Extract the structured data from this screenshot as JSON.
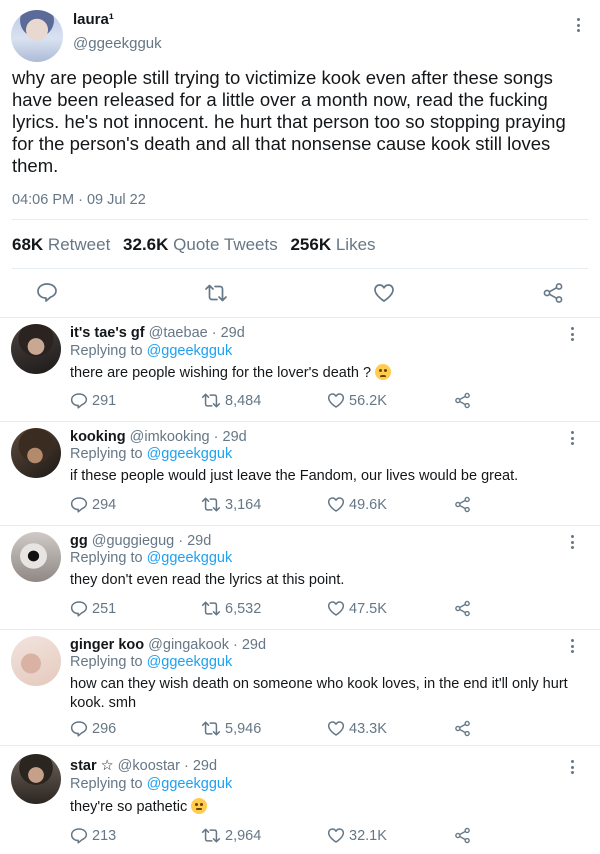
{
  "main_tweet": {
    "display_name": "laura¹",
    "handle": "@ggeekgguk",
    "text": "why are people still trying to victimize kook even after these songs have been released for a little over a month now, read the fucking lyrics. he's not innocent. he hurt that person too so stopping praying for the person's death and all that nonsense cause kook still loves them.",
    "timestamp": "04:06 PM · 09 Jul 22",
    "stats": {
      "retweets_count": "68K",
      "retweets_label": "Retweet",
      "quotes_count": "32.6K",
      "quotes_label": "Quote Tweets",
      "likes_count": "256K",
      "likes_label": "Likes"
    },
    "actions": [
      "reply-icon",
      "retweet-icon",
      "like-icon",
      "share-icon"
    ]
  },
  "replying_label": "Replying to",
  "replies": [
    {
      "name": "it's tae's gf",
      "meta": "@taebae · 29d",
      "replying_to": "@ggeekgguk",
      "text": "there are people wishing for the lover's death ?",
      "emoji": "worried-face",
      "reply_count": "291",
      "retweet_count": "8,484",
      "like_count": "56.2K"
    },
    {
      "name": "kooking",
      "meta": "@imkooking · 29d",
      "replying_to": "@ggeekgguk",
      "text": "if these people would just leave the Fandom, our lives would be great.",
      "reply_count": "294",
      "retweet_count": "3,164",
      "like_count": "49.6K"
    },
    {
      "name": "gg",
      "meta": "@guggiegug · 29d",
      "replying_to": "@ggeekgguk",
      "text": "they don't even read the lyrics at this point.",
      "reply_count": "251",
      "retweet_count": "6,532",
      "like_count": "47.5K"
    },
    {
      "name": "ginger koo",
      "meta": "@gingakook · 29d",
      "replying_to": "@ggeekgguk",
      "text": "how can they wish death on someone who kook loves, in the end it'll only hurt kook. smh",
      "reply_count": "296",
      "retweet_count": "5,946",
      "like_count": "43.3K"
    },
    {
      "name": "star ☆",
      "meta": "@koostar · 29d",
      "replying_to": "@ggeekgguk",
      "text": "they're so pathetic",
      "emoji": "rolling-eyes-face",
      "reply_count": "213",
      "retweet_count": "2,964",
      "like_count": "32.1K"
    }
  ],
  "colors": {
    "text": "#14171a",
    "secondary": "#657786",
    "link": "#1da1f2",
    "divider": "#e6ecf0"
  }
}
